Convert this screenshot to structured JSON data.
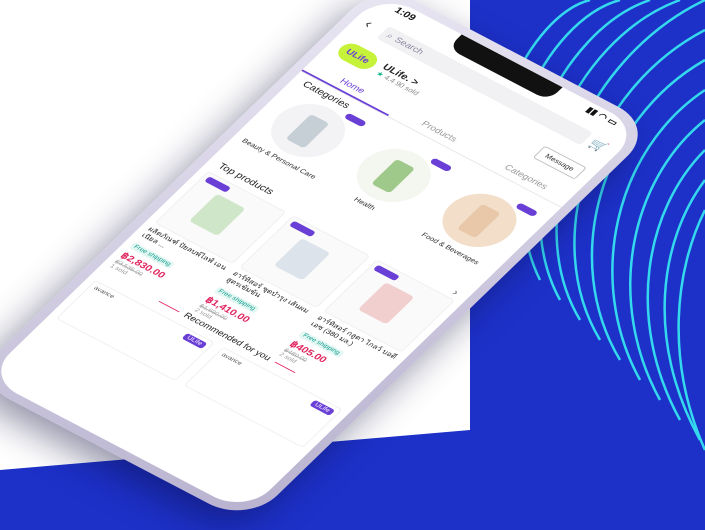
{
  "colors": {
    "primary": "#6a3fd6",
    "price": "#e0245e",
    "bg_blue": "#1d31c9",
    "logo_bg": "#c6f23a"
  },
  "status_bar": {
    "time": "1:09"
  },
  "search": {
    "placeholder": "Search"
  },
  "shop": {
    "logo": "ULife",
    "name": "ULife. >",
    "rating": "4.4",
    "sold": "90 sold",
    "message_label": "Message"
  },
  "tabs": [
    "Home",
    "Products",
    "Categories"
  ],
  "categories": {
    "title": "Categories",
    "items": [
      "Beauty & Personal Care",
      "Health",
      "Food & Beverages"
    ]
  },
  "top_products": {
    "title": "Top products",
    "items": [
      {
        "name": "ผลิตภัณฑ์ ปัยลบพ์ไลฟ์ เอนเนียล ...",
        "shipping": "Free shipping",
        "price": "฿2,830.00",
        "old_price": "฿3,535.00",
        "sold": "1 sold"
      },
      {
        "name": "อาร์ทิสอร์ ชุดบำรุง เส้นผม สูตรเข้มข้น",
        "shipping": "Free shipping",
        "price": "฿1,410.00",
        "old_price": "฿1,690.00",
        "sold": "2 sold"
      },
      {
        "name": "อาร์ทิสอร์ กลูตา ไกลว์ บอดี้ เอซ (380 มล.)",
        "shipping": "Free shipping",
        "price": "฿405.00",
        "old_price": "฿480.00",
        "sold": "2 sold"
      }
    ]
  },
  "recommended": {
    "title": "Recommended for you",
    "cards": [
      {
        "brand": "avance",
        "label": "ULife"
      },
      {
        "brand": "avance",
        "label": "ULife"
      }
    ]
  }
}
